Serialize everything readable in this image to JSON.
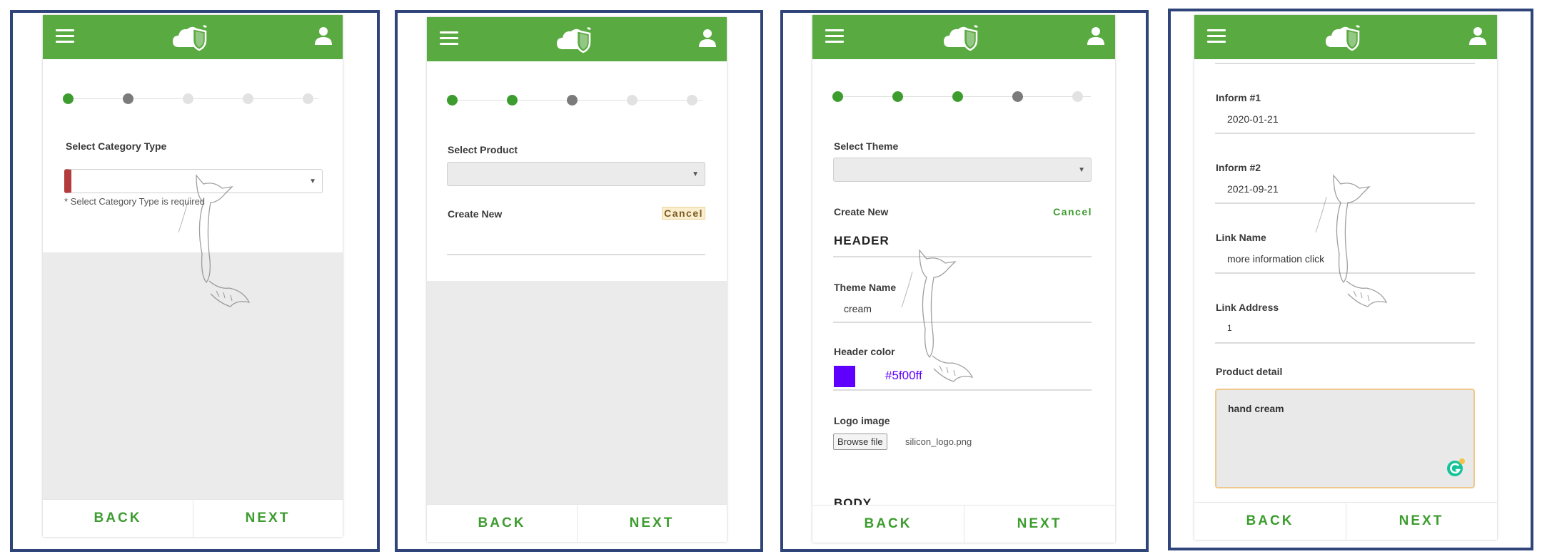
{
  "common": {
    "back_label": "BACK",
    "next_label": "NEXT",
    "brand_color": "#5aaa42",
    "accent_color": "#3c9c2e"
  },
  "screen1": {
    "steps": [
      "active",
      "current",
      "pending",
      "pending",
      "pending"
    ],
    "field_label": "Select Category Type",
    "select_value": "",
    "error_text": "* Select Category Type is required"
  },
  "screen2": {
    "steps": [
      "active",
      "active",
      "current",
      "pending",
      "pending"
    ],
    "field_label": "Select Product",
    "select_value": "",
    "create_new_label": "Create New",
    "cancel_label": "Cancel"
  },
  "screen3": {
    "steps": [
      "active",
      "active",
      "active",
      "current",
      "pending"
    ],
    "field_label": "Select Theme",
    "select_value": "",
    "create_new_label": "Create New",
    "cancel_label": "Cancel",
    "header_section": "HEADER",
    "theme_name_label": "Theme Name",
    "theme_name_value": "cream",
    "header_color_label": "Header color",
    "header_color_value": "#5f00ff",
    "header_color_text": "#5f00ff",
    "logo_image_label": "Logo image",
    "browse_label": "Browse file",
    "file_name": "silicon_logo.png",
    "body_section": "BODY"
  },
  "screen4": {
    "inform1_label": "Inform #1",
    "inform1_value": "2020-01-21",
    "inform2_label": "Inform #2",
    "inform2_value": "2021-09-21",
    "link_name_label": "Link Name",
    "link_name_value": "more information click",
    "link_address_label": "Link Address",
    "link_address_value": "1",
    "product_detail_label": "Product detail",
    "product_detail_value": "hand cream"
  }
}
